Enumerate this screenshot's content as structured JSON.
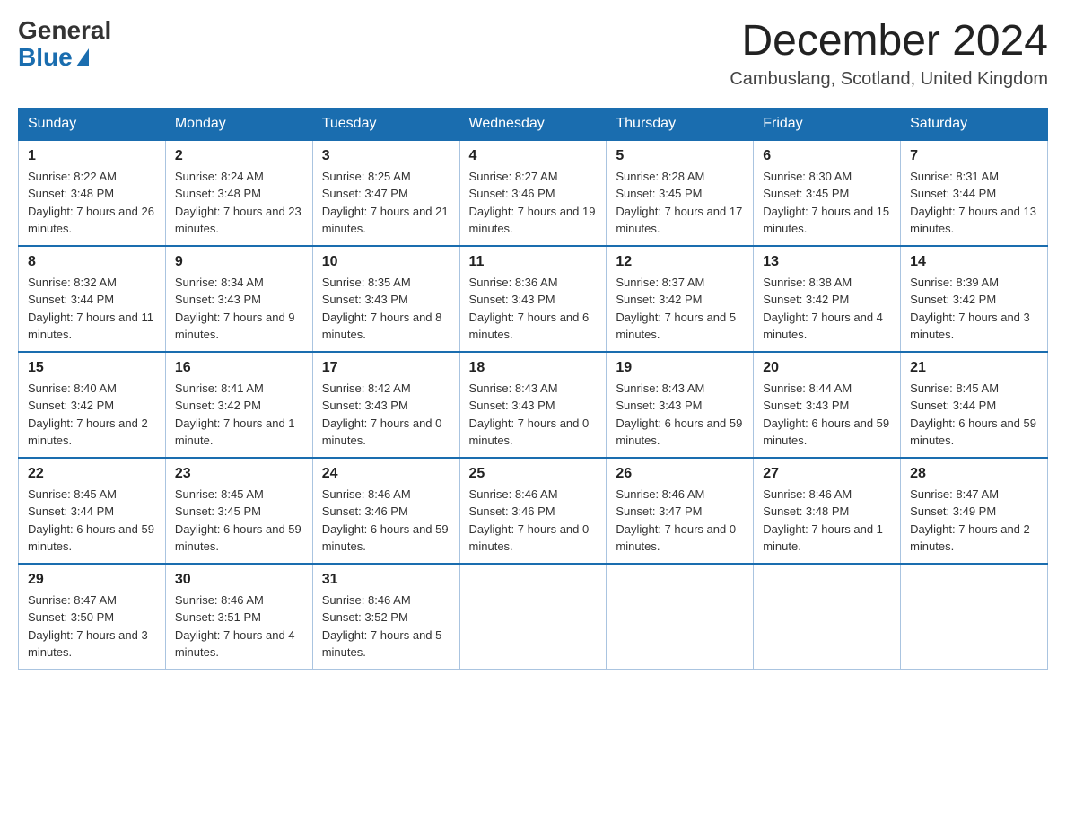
{
  "logo": {
    "general": "General",
    "blue": "Blue"
  },
  "title": "December 2024",
  "location": "Cambuslang, Scotland, United Kingdom",
  "days_of_week": [
    "Sunday",
    "Monday",
    "Tuesday",
    "Wednesday",
    "Thursday",
    "Friday",
    "Saturday"
  ],
  "weeks": [
    [
      {
        "day": "1",
        "sunrise": "Sunrise: 8:22 AM",
        "sunset": "Sunset: 3:48 PM",
        "daylight": "Daylight: 7 hours and 26 minutes."
      },
      {
        "day": "2",
        "sunrise": "Sunrise: 8:24 AM",
        "sunset": "Sunset: 3:48 PM",
        "daylight": "Daylight: 7 hours and 23 minutes."
      },
      {
        "day": "3",
        "sunrise": "Sunrise: 8:25 AM",
        "sunset": "Sunset: 3:47 PM",
        "daylight": "Daylight: 7 hours and 21 minutes."
      },
      {
        "day": "4",
        "sunrise": "Sunrise: 8:27 AM",
        "sunset": "Sunset: 3:46 PM",
        "daylight": "Daylight: 7 hours and 19 minutes."
      },
      {
        "day": "5",
        "sunrise": "Sunrise: 8:28 AM",
        "sunset": "Sunset: 3:45 PM",
        "daylight": "Daylight: 7 hours and 17 minutes."
      },
      {
        "day": "6",
        "sunrise": "Sunrise: 8:30 AM",
        "sunset": "Sunset: 3:45 PM",
        "daylight": "Daylight: 7 hours and 15 minutes."
      },
      {
        "day": "7",
        "sunrise": "Sunrise: 8:31 AM",
        "sunset": "Sunset: 3:44 PM",
        "daylight": "Daylight: 7 hours and 13 minutes."
      }
    ],
    [
      {
        "day": "8",
        "sunrise": "Sunrise: 8:32 AM",
        "sunset": "Sunset: 3:44 PM",
        "daylight": "Daylight: 7 hours and 11 minutes."
      },
      {
        "day": "9",
        "sunrise": "Sunrise: 8:34 AM",
        "sunset": "Sunset: 3:43 PM",
        "daylight": "Daylight: 7 hours and 9 minutes."
      },
      {
        "day": "10",
        "sunrise": "Sunrise: 8:35 AM",
        "sunset": "Sunset: 3:43 PM",
        "daylight": "Daylight: 7 hours and 8 minutes."
      },
      {
        "day": "11",
        "sunrise": "Sunrise: 8:36 AM",
        "sunset": "Sunset: 3:43 PM",
        "daylight": "Daylight: 7 hours and 6 minutes."
      },
      {
        "day": "12",
        "sunrise": "Sunrise: 8:37 AM",
        "sunset": "Sunset: 3:42 PM",
        "daylight": "Daylight: 7 hours and 5 minutes."
      },
      {
        "day": "13",
        "sunrise": "Sunrise: 8:38 AM",
        "sunset": "Sunset: 3:42 PM",
        "daylight": "Daylight: 7 hours and 4 minutes."
      },
      {
        "day": "14",
        "sunrise": "Sunrise: 8:39 AM",
        "sunset": "Sunset: 3:42 PM",
        "daylight": "Daylight: 7 hours and 3 minutes."
      }
    ],
    [
      {
        "day": "15",
        "sunrise": "Sunrise: 8:40 AM",
        "sunset": "Sunset: 3:42 PM",
        "daylight": "Daylight: 7 hours and 2 minutes."
      },
      {
        "day": "16",
        "sunrise": "Sunrise: 8:41 AM",
        "sunset": "Sunset: 3:42 PM",
        "daylight": "Daylight: 7 hours and 1 minute."
      },
      {
        "day": "17",
        "sunrise": "Sunrise: 8:42 AM",
        "sunset": "Sunset: 3:43 PM",
        "daylight": "Daylight: 7 hours and 0 minutes."
      },
      {
        "day": "18",
        "sunrise": "Sunrise: 8:43 AM",
        "sunset": "Sunset: 3:43 PM",
        "daylight": "Daylight: 7 hours and 0 minutes."
      },
      {
        "day": "19",
        "sunrise": "Sunrise: 8:43 AM",
        "sunset": "Sunset: 3:43 PM",
        "daylight": "Daylight: 6 hours and 59 minutes."
      },
      {
        "day": "20",
        "sunrise": "Sunrise: 8:44 AM",
        "sunset": "Sunset: 3:43 PM",
        "daylight": "Daylight: 6 hours and 59 minutes."
      },
      {
        "day": "21",
        "sunrise": "Sunrise: 8:45 AM",
        "sunset": "Sunset: 3:44 PM",
        "daylight": "Daylight: 6 hours and 59 minutes."
      }
    ],
    [
      {
        "day": "22",
        "sunrise": "Sunrise: 8:45 AM",
        "sunset": "Sunset: 3:44 PM",
        "daylight": "Daylight: 6 hours and 59 minutes."
      },
      {
        "day": "23",
        "sunrise": "Sunrise: 8:45 AM",
        "sunset": "Sunset: 3:45 PM",
        "daylight": "Daylight: 6 hours and 59 minutes."
      },
      {
        "day": "24",
        "sunrise": "Sunrise: 8:46 AM",
        "sunset": "Sunset: 3:46 PM",
        "daylight": "Daylight: 6 hours and 59 minutes."
      },
      {
        "day": "25",
        "sunrise": "Sunrise: 8:46 AM",
        "sunset": "Sunset: 3:46 PM",
        "daylight": "Daylight: 7 hours and 0 minutes."
      },
      {
        "day": "26",
        "sunrise": "Sunrise: 8:46 AM",
        "sunset": "Sunset: 3:47 PM",
        "daylight": "Daylight: 7 hours and 0 minutes."
      },
      {
        "day": "27",
        "sunrise": "Sunrise: 8:46 AM",
        "sunset": "Sunset: 3:48 PM",
        "daylight": "Daylight: 7 hours and 1 minute."
      },
      {
        "day": "28",
        "sunrise": "Sunrise: 8:47 AM",
        "sunset": "Sunset: 3:49 PM",
        "daylight": "Daylight: 7 hours and 2 minutes."
      }
    ],
    [
      {
        "day": "29",
        "sunrise": "Sunrise: 8:47 AM",
        "sunset": "Sunset: 3:50 PM",
        "daylight": "Daylight: 7 hours and 3 minutes."
      },
      {
        "day": "30",
        "sunrise": "Sunrise: 8:46 AM",
        "sunset": "Sunset: 3:51 PM",
        "daylight": "Daylight: 7 hours and 4 minutes."
      },
      {
        "day": "31",
        "sunrise": "Sunrise: 8:46 AM",
        "sunset": "Sunset: 3:52 PM",
        "daylight": "Daylight: 7 hours and 5 minutes."
      },
      null,
      null,
      null,
      null
    ]
  ]
}
